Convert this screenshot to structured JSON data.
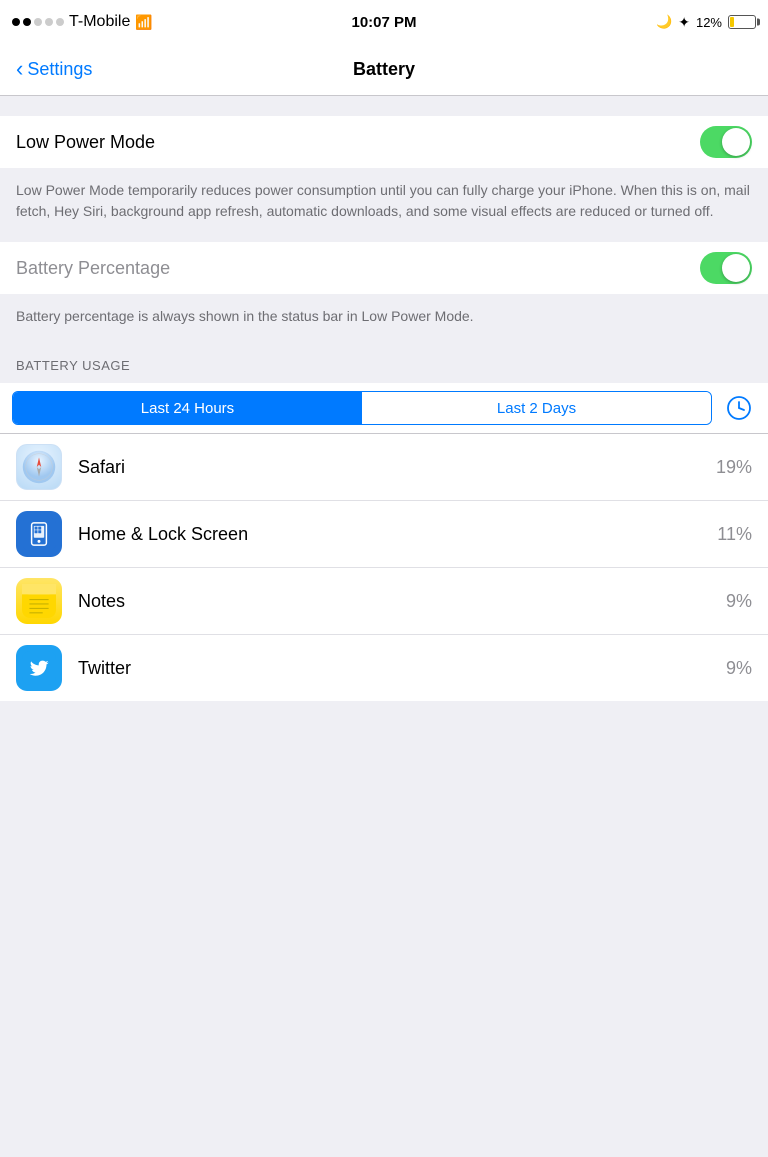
{
  "statusBar": {
    "carrier": "T-Mobile",
    "time": "10:07 PM",
    "batteryPercent": "12%",
    "signalFilled": 2,
    "signalEmpty": 3
  },
  "navBar": {
    "backLabel": "Settings",
    "title": "Battery"
  },
  "lowPowerMode": {
    "label": "Low Power Mode",
    "enabled": true,
    "description": "Low Power Mode temporarily reduces power consumption until you can fully charge your iPhone. When this is on, mail fetch, Hey Siri, background app refresh, automatic downloads, and some visual effects are reduced or turned off."
  },
  "batteryPercentage": {
    "label": "Battery Percentage",
    "enabled": true,
    "description": "Battery percentage is always shown in the status bar in Low Power Mode."
  },
  "batteryUsage": {
    "sectionHeader": "BATTERY USAGE",
    "segment": {
      "option1": "Last 24 Hours",
      "option2": "Last 2 Days",
      "activeIndex": 0
    },
    "apps": [
      {
        "name": "Safari",
        "percent": "19%",
        "icon": "safari"
      },
      {
        "name": "Home & Lock Screen",
        "percent": "11%",
        "icon": "homescreen"
      },
      {
        "name": "Notes",
        "percent": "9%",
        "icon": "notes"
      },
      {
        "name": "Twitter",
        "percent": "9%",
        "icon": "twitter"
      }
    ]
  }
}
